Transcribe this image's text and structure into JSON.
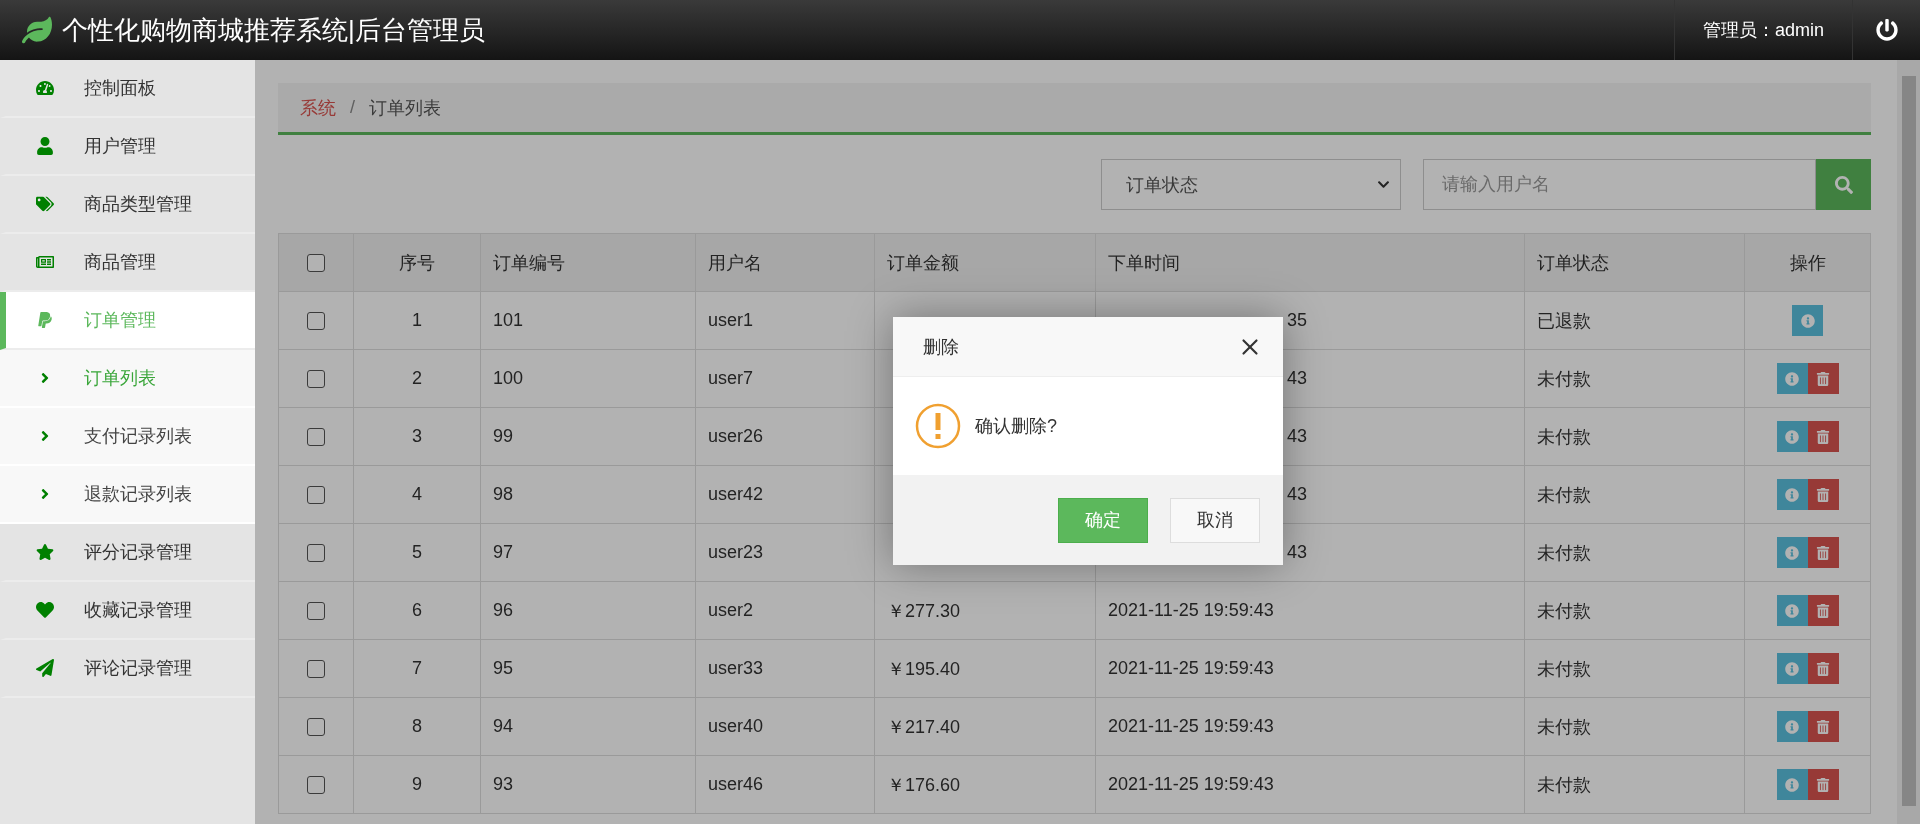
{
  "header": {
    "title": "个性化购物商城推荐系统|后台管理员",
    "user": "管理员：admin"
  },
  "sidebar": {
    "items": [
      {
        "label": "控制面板",
        "selected": false
      },
      {
        "label": "用户管理",
        "selected": false
      },
      {
        "label": "商品类型管理",
        "selected": false
      },
      {
        "label": "商品管理",
        "selected": false
      },
      {
        "label": "订单管理",
        "selected": true,
        "children": [
          {
            "label": "订单列表",
            "selected": true
          },
          {
            "label": "支付记录列表",
            "selected": false
          },
          {
            "label": "退款记录列表",
            "selected": false
          }
        ]
      },
      {
        "label": "评分记录管理",
        "selected": false
      },
      {
        "label": "收藏记录管理",
        "selected": false
      },
      {
        "label": "评论记录管理",
        "selected": false
      }
    ]
  },
  "breadcrumb": {
    "items": [
      "系统",
      "订单列表"
    ],
    "separator": "/"
  },
  "filters": {
    "status_select": {
      "value": "订单状态"
    },
    "search": {
      "placeholder": "请输入用户名"
    }
  },
  "table": {
    "all_checked": false,
    "columns": [
      "序号",
      "订单编号",
      "用户名",
      "订单金额",
      "下单时间",
      "订单状态",
      "操作"
    ],
    "rows": [
      {
        "checked": false,
        "index": "1",
        "order_no": "101",
        "user": "user1",
        "covered": true,
        "time": "35",
        "status": "已退款",
        "actions": [
          {
            "kind": "info"
          }
        ]
      },
      {
        "checked": false,
        "index": "2",
        "order_no": "100",
        "user": "user7",
        "covered": true,
        "time": "43",
        "status": "未付款",
        "actions": [
          {
            "kind": "info"
          },
          {
            "kind": "delete"
          }
        ]
      },
      {
        "checked": false,
        "index": "3",
        "order_no": "99",
        "user": "user26",
        "covered": true,
        "time": "43",
        "status": "未付款",
        "actions": [
          {
            "kind": "info"
          },
          {
            "kind": "delete"
          }
        ]
      },
      {
        "checked": false,
        "index": "4",
        "order_no": "98",
        "user": "user42",
        "covered": true,
        "time": "43",
        "status": "未付款",
        "actions": [
          {
            "kind": "info"
          },
          {
            "kind": "delete"
          }
        ]
      },
      {
        "checked": false,
        "index": "5",
        "order_no": "97",
        "user": "user23",
        "covered": true,
        "time": "43",
        "status": "未付款",
        "actions": [
          {
            "kind": "info"
          },
          {
            "kind": "delete"
          }
        ]
      },
      {
        "checked": false,
        "index": "6",
        "order_no": "96",
        "user": "user2",
        "covered": false,
        "amount": "￥277.30",
        "time": "2021-11-25 19:59:43",
        "status": "未付款",
        "actions": [
          {
            "kind": "info"
          },
          {
            "kind": "delete"
          }
        ]
      },
      {
        "checked": false,
        "index": "7",
        "order_no": "95",
        "user": "user33",
        "covered": false,
        "amount": "￥195.40",
        "time": "2021-11-25 19:59:43",
        "status": "未付款",
        "actions": [
          {
            "kind": "info"
          },
          {
            "kind": "delete"
          }
        ]
      },
      {
        "checked": false,
        "index": "8",
        "order_no": "94",
        "user": "user40",
        "covered": false,
        "amount": "￥217.40",
        "time": "2021-11-25 19:59:43",
        "status": "未付款",
        "actions": [
          {
            "kind": "info"
          },
          {
            "kind": "delete"
          }
        ]
      },
      {
        "checked": false,
        "index": "9",
        "order_no": "93",
        "user": "user46",
        "covered": false,
        "amount": "￥176.60",
        "time": "2021-11-25 19:59:43",
        "status": "未付款",
        "actions": [
          {
            "kind": "info"
          },
          {
            "kind": "delete"
          }
        ]
      }
    ]
  },
  "modal": {
    "title": "删除",
    "message": "确认删除?",
    "buttons": [
      {
        "label": "确定",
        "kind": "primary"
      },
      {
        "label": "取消",
        "kind": "default"
      }
    ]
  }
}
